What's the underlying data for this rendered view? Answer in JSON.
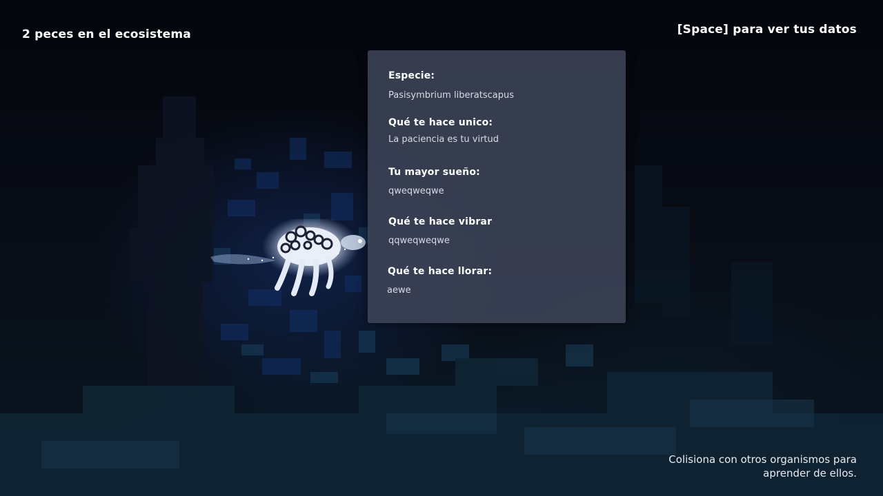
{
  "hud": {
    "fish_count": "2 peces en el ecosistema",
    "space_hint": "[Space] para ver tus datos",
    "collide_hint_line1": "Colisiona con otros organismos para",
    "collide_hint_line2": "aprender de ellos."
  },
  "panel": {
    "fields": [
      {
        "label": "Especie:",
        "value": "Pasisymbrium liberatscapus"
      },
      {
        "label": "Qué te hace unico:",
        "value": "La paciencia es tu virtud"
      },
      {
        "label": "Tu mayor sueño:",
        "value": "qweqweqwe"
      },
      {
        "label": "Qué te hace vibrar",
        "value": "qqweqweqwe"
      },
      {
        "label": "Qué te hace llorar:",
        "value": "aewe"
      }
    ]
  },
  "colors": {
    "panel_bg": "#3e4458",
    "hud_text": "#ffffff",
    "background": "#05080f"
  },
  "icons": {
    "player": "glowing-fish-icon"
  }
}
